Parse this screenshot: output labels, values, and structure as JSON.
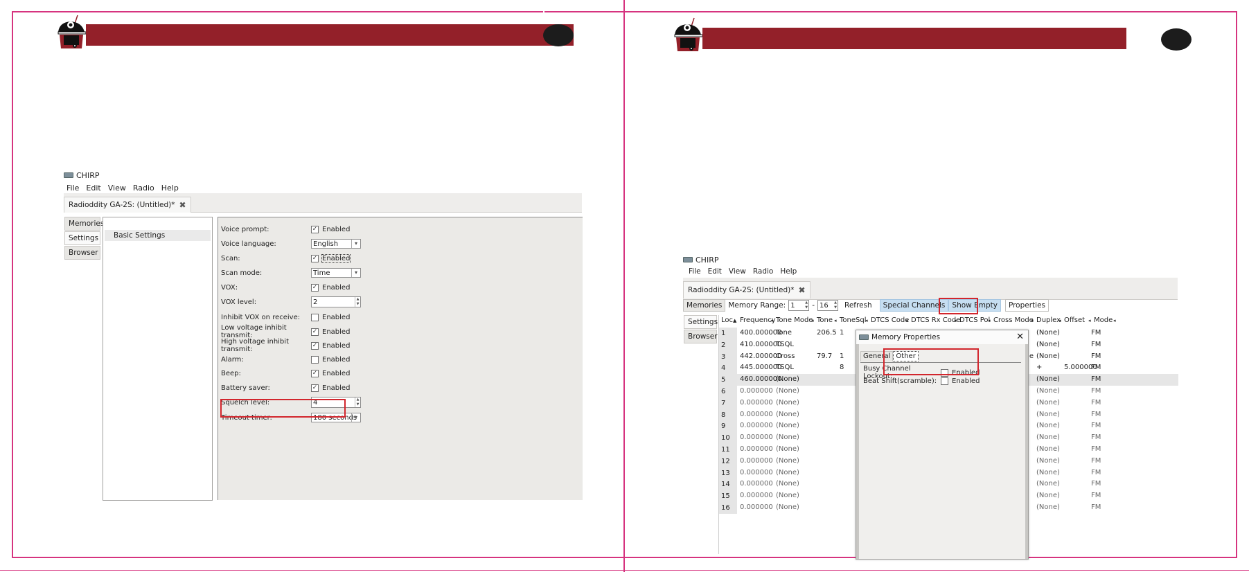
{
  "app": {
    "title": "CHIRP",
    "menu": [
      "File",
      "Edit",
      "View",
      "Radio",
      "Help"
    ],
    "doc_tab": "Radioddity GA-2S: (Untitled)*",
    "side_tabs": [
      "Memories",
      "Settings",
      "Browser"
    ]
  },
  "settings": {
    "tree_item": "Basic Settings",
    "rows": [
      {
        "label": "Voice prompt:",
        "kind": "check",
        "checked": true,
        "value": "Enabled"
      },
      {
        "label": "Voice language:",
        "kind": "combo",
        "value": "English"
      },
      {
        "label": "Scan:",
        "kind": "check",
        "checked": true,
        "value": "Enabled"
      },
      {
        "label": "Scan mode:",
        "kind": "combo",
        "value": "Time"
      },
      {
        "label": "VOX:",
        "kind": "check",
        "checked": true,
        "value": "Enabled"
      },
      {
        "label": "VOX level:",
        "kind": "spin",
        "value": "2"
      },
      {
        "label": "Inhibit VOX on receive:",
        "kind": "check",
        "checked": false,
        "value": "Enabled"
      },
      {
        "label": "Low voltage inhibit transmit:",
        "kind": "check",
        "checked": true,
        "value": "Enabled"
      },
      {
        "label": "High voltage inhibit transmit:",
        "kind": "check",
        "checked": true,
        "value": "Enabled"
      },
      {
        "label": "Alarm:",
        "kind": "check",
        "checked": false,
        "value": "Enabled"
      },
      {
        "label": "Beep:",
        "kind": "check",
        "checked": true,
        "value": "Enabled"
      },
      {
        "label": "Battery saver:",
        "kind": "check",
        "checked": true,
        "value": "Enabled"
      },
      {
        "label": "Squelch level:",
        "kind": "spin",
        "value": "4"
      },
      {
        "label": "Timeout timer:",
        "kind": "combo",
        "value": "180 seconds"
      }
    ]
  },
  "memories": {
    "tab_label": "Memories",
    "range_label": "Memory Range:",
    "range_from": "1",
    "range_sep": "-",
    "range_to": "16",
    "refresh": "Refresh",
    "special_channels": "Special Channels",
    "show_empty": "Show Empty",
    "properties": "Properties",
    "columns": [
      "Loc",
      "Frequency",
      "Tone Mode",
      "Tone",
      "ToneSql",
      "DTCS Code",
      "DTCS Rx Code",
      "DTCS Pol",
      "Cross Mode",
      "Duplex",
      "Offset",
      "Mode"
    ],
    "rows": [
      {
        "loc": "1",
        "freq": "400.000000",
        "tmode": "Tone",
        "tone": "206.5",
        "tsql": "1",
        "cross": "",
        "duplex": "(None)",
        "offset": "",
        "mode": "FM"
      },
      {
        "loc": "2",
        "freq": "410.000000",
        "tmode": "TSQL",
        "tone": "",
        "tsql": "",
        "cross": "",
        "duplex": "(None)",
        "offset": "",
        "mode": "FM"
      },
      {
        "loc": "3",
        "freq": "442.000000",
        "tmode": "Cross",
        "tone": "79.7",
        "tsql": "1",
        "cross": "Tone->Tone",
        "duplex": "(None)",
        "offset": "",
        "mode": "FM"
      },
      {
        "loc": "4",
        "freq": "445.000000",
        "tmode": "TSQL",
        "tone": "",
        "tsql": "8",
        "cross": "",
        "duplex": "+",
        "offset": "5.000000",
        "mode": "FM"
      },
      {
        "loc": "5",
        "freq": "460.000000",
        "tmode": "(None)",
        "tone": "",
        "tsql": "",
        "cross": "",
        "duplex": "(None)",
        "offset": "",
        "mode": "FM"
      },
      {
        "loc": "6",
        "freq": "0.000000",
        "tmode": "(None)",
        "tone": "",
        "tsql": "",
        "cross": "",
        "duplex": "(None)",
        "offset": "",
        "mode": "FM"
      },
      {
        "loc": "7",
        "freq": "0.000000",
        "tmode": "(None)",
        "tone": "",
        "tsql": "",
        "cross": "",
        "duplex": "(None)",
        "offset": "",
        "mode": "FM"
      },
      {
        "loc": "8",
        "freq": "0.000000",
        "tmode": "(None)",
        "tone": "",
        "tsql": "",
        "cross": "",
        "duplex": "(None)",
        "offset": "",
        "mode": "FM"
      },
      {
        "loc": "9",
        "freq": "0.000000",
        "tmode": "(None)",
        "tone": "",
        "tsql": "",
        "cross": "",
        "duplex": "(None)",
        "offset": "",
        "mode": "FM"
      },
      {
        "loc": "10",
        "freq": "0.000000",
        "tmode": "(None)",
        "tone": "",
        "tsql": "",
        "cross": "",
        "duplex": "(None)",
        "offset": "",
        "mode": "FM"
      },
      {
        "loc": "11",
        "freq": "0.000000",
        "tmode": "(None)",
        "tone": "",
        "tsql": "",
        "cross": "",
        "duplex": "(None)",
        "offset": "",
        "mode": "FM"
      },
      {
        "loc": "12",
        "freq": "0.000000",
        "tmode": "(None)",
        "tone": "",
        "tsql": "",
        "cross": "",
        "duplex": "(None)",
        "offset": "",
        "mode": "FM"
      },
      {
        "loc": "13",
        "freq": "0.000000",
        "tmode": "(None)",
        "tone": "",
        "tsql": "",
        "cross": "",
        "duplex": "(None)",
        "offset": "",
        "mode": "FM"
      },
      {
        "loc": "14",
        "freq": "0.000000",
        "tmode": "(None)",
        "tone": "",
        "tsql": "",
        "cross": "",
        "duplex": "(None)",
        "offset": "",
        "mode": "FM"
      },
      {
        "loc": "15",
        "freq": "0.000000",
        "tmode": "(None)",
        "tone": "",
        "tsql": "",
        "cross": "",
        "duplex": "(None)",
        "offset": "",
        "mode": "FM"
      },
      {
        "loc": "16",
        "freq": "0.000000",
        "tmode": "(None)",
        "tone": "",
        "tsql": "",
        "cross": "",
        "duplex": "(None)",
        "offset": "",
        "mode": "FM"
      }
    ]
  },
  "dialog": {
    "title": "Memory Properties",
    "tabs": [
      "General",
      "Other"
    ],
    "rows": [
      {
        "label": "Busy Channel Lockout:",
        "checked": false,
        "value": "Enabled"
      },
      {
        "label": "Beat Shift(scramble):",
        "checked": false,
        "value": "Enabled"
      }
    ]
  },
  "colors": {
    "banner": "#932029",
    "guide": "#d6337f",
    "highlight": "#d2262d",
    "button_blue": "#c6def1"
  }
}
